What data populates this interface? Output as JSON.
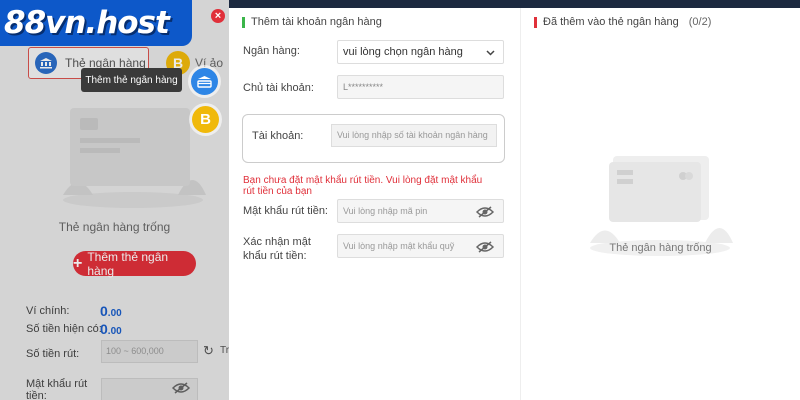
{
  "brand": {
    "logo_text": "88vn.host"
  },
  "left": {
    "tabs": {
      "bank_label": "Thẻ ngân hàng",
      "virtual_label": "Ví ảo"
    },
    "tooltip": "Thêm thẻ ngân hàng",
    "coin_symbol": "B",
    "empty_text": "Thẻ ngân hàng trống",
    "add_button": {
      "plus": "+",
      "label": "Thêm thẻ ngân hàng"
    },
    "balances": [
      {
        "label": "Ví chính:",
        "int": "0",
        "dec": ".00"
      },
      {
        "label": "Số tiền hiện có:",
        "int": "0",
        "dec": ".00"
      }
    ],
    "withdraw": {
      "label": "Số tiền rút:",
      "placeholder": "100 ~ 600,000",
      "refresh_icon": "↻",
      "refresh_text": "Tr"
    },
    "pin_label": "Mật khẩu rút tiền:"
  },
  "form": {
    "title": "Thêm tài khoản ngân hàng",
    "bank_label": "Ngân hàng:",
    "bank_select": "vui lòng chọn ngân hàng",
    "holder_label": "Chủ tài khoản:",
    "holder_value": "L**********",
    "account_label": "Tài khoản:",
    "account_placeholder": "Vui lòng nhập số tài khoản ngân hàng",
    "warning": "Bạn chưa đặt mật khẩu rút tiền. Vui lòng đặt mật khẩu rút tiền của bạn",
    "pin_label": "Mật khẩu rút tiền:",
    "pin_placeholder": "Vui lòng nhập mã pin",
    "confirm_label": "Xác nhận mật khẩu rút tiền:",
    "confirm_placeholder": "Vui lòng nhập mật khẩu quỹ"
  },
  "added": {
    "title": "Đã thêm vào thẻ ngân hàng",
    "count": "(0/2)",
    "empty_text": "Thẻ ngân hàng trống"
  },
  "colors": {
    "brand_blue": "#0d58c9",
    "accent_red": "#e0303a",
    "coin_gold": "#f0b90b",
    "ok_green": "#3bb54a"
  }
}
